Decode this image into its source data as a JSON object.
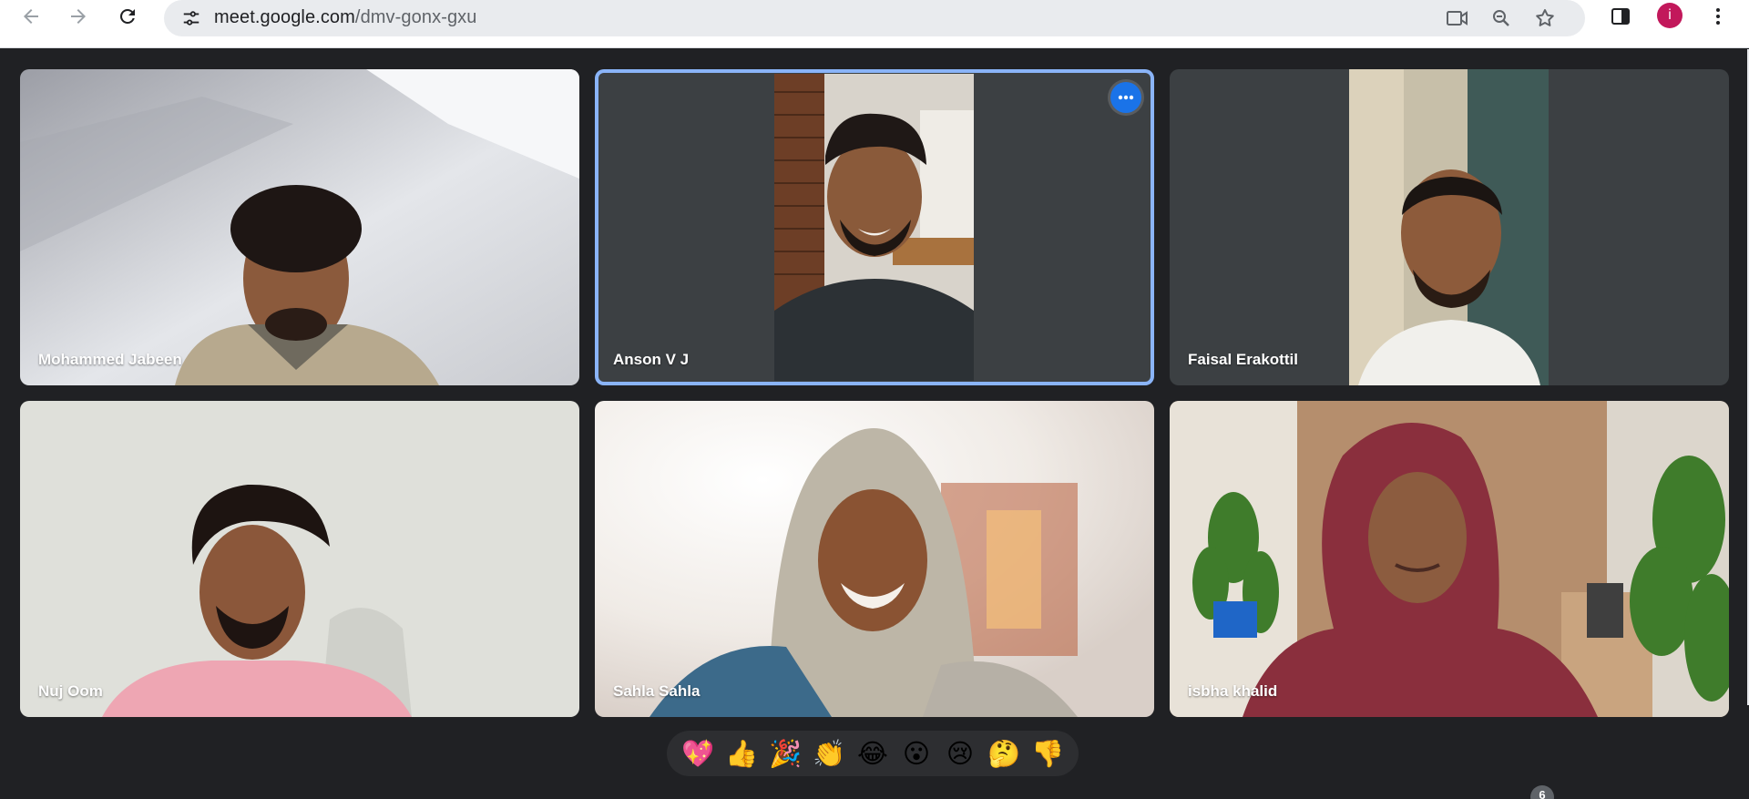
{
  "browser": {
    "url_host": "meet.google.com",
    "url_path": "/dmv-gonx-gxu",
    "profile_initial": "i",
    "icons": [
      "back-arrow-icon",
      "forward-arrow-icon",
      "reload-icon",
      "site-info-icon",
      "camera-blocked-icon",
      "zoom-icon",
      "bookmark-star-icon",
      "side-panel-icon",
      "kebab-menu-icon"
    ]
  },
  "participants": [
    {
      "name": "Mohammed Jabeen"
    },
    {
      "name": "Anson V J"
    },
    {
      "name": "Faisal Erakottil"
    },
    {
      "name": "Nuj Oom"
    },
    {
      "name": "Sahla Sahla"
    },
    {
      "name": "isbha khalid"
    }
  ],
  "reactions": [
    "💖",
    "👍",
    "🎉",
    "👏",
    "😂",
    "😮",
    "😢",
    "🤔",
    "👎"
  ],
  "participant_count": "6",
  "colors": {
    "accent": "#8ab4f8",
    "meet_bg": "#202124",
    "tile_bg": "#3c4043",
    "avatar": "#c2185b"
  }
}
